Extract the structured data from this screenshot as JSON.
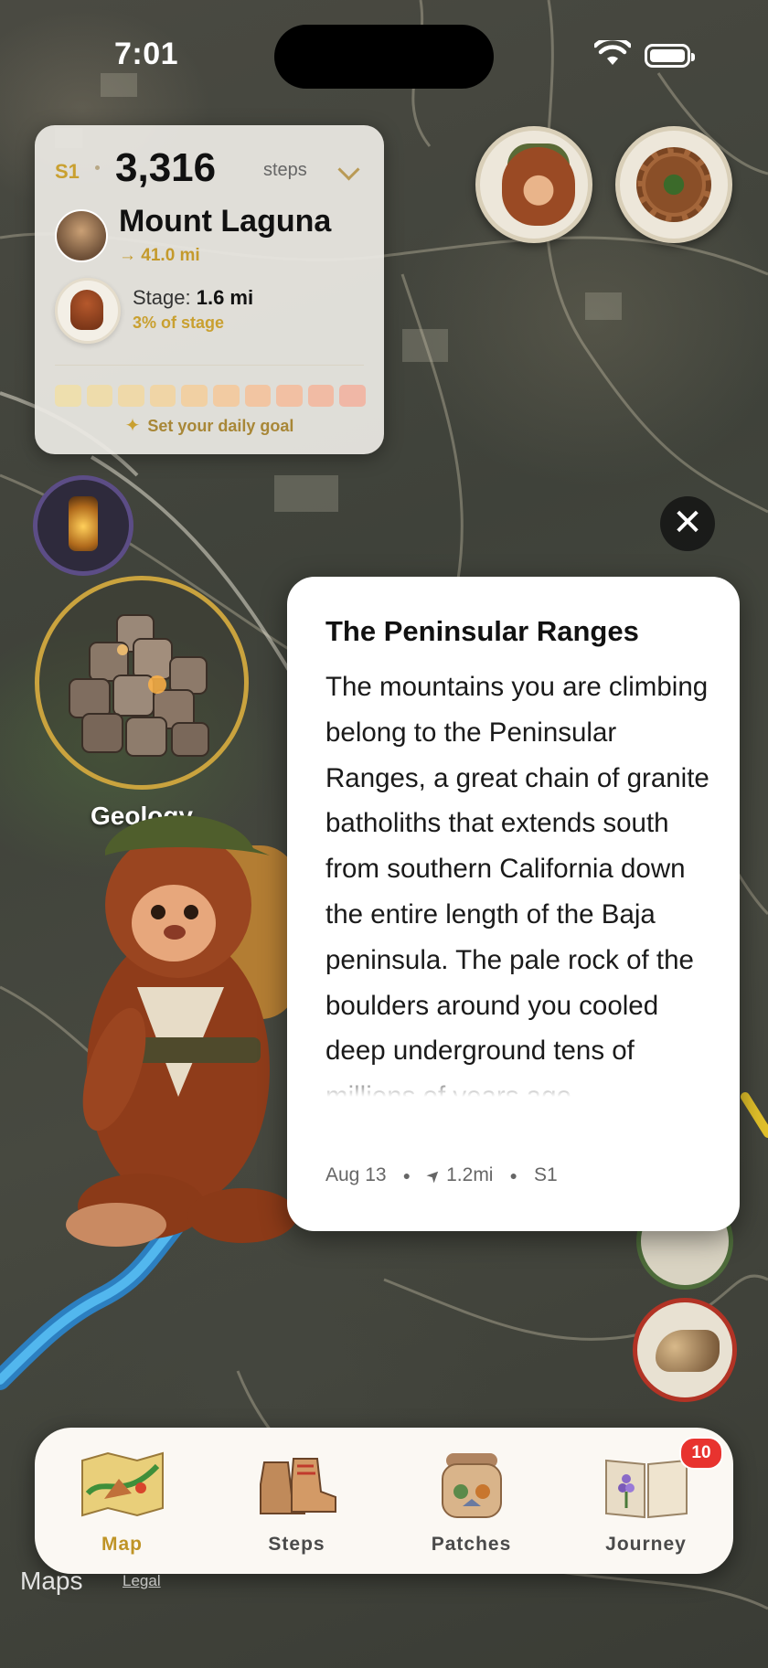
{
  "status_bar": {
    "time": "7:01"
  },
  "stats_card": {
    "season": "S1",
    "steps_value": "3,316",
    "steps_label": "steps",
    "destination": "Mount Laguna",
    "destination_distance": "→ 41.0 mi",
    "stage_label": "Stage:",
    "stage_value": "1.6 mi",
    "stage_progress": "3% of stage",
    "stage_progress_fraction": 0.03,
    "daily_goal_text": "Set your daily goal",
    "goal_segment_colors": [
      "#eedfae",
      "#eedcab",
      "#efd9a9",
      "#f0d5a6",
      "#f1d0a3",
      "#f2cba2",
      "#f2c5a2",
      "#f2c0a3",
      "#f1bba4",
      "#f0b7a6"
    ]
  },
  "map_markers": {
    "geology_label": "Geology"
  },
  "info_card": {
    "title": "The Peninsular Ranges",
    "body": "The mountains you are climbing belong to the Peninsular Ranges, a great chain of granite batholiths that extends south from southern California down the entire length of the Baja peninsula. The pale rock of the boulders around you cooled deep underground tens of millions of years ago",
    "date": "Aug 13",
    "distance": "1.2mi",
    "season": "S1"
  },
  "tab_bar": {
    "tabs": [
      {
        "label": "Map",
        "icon": "map-icon",
        "active": true
      },
      {
        "label": "Steps",
        "icon": "boots-icon",
        "active": false
      },
      {
        "label": "Patches",
        "icon": "backpack-icon",
        "active": false
      },
      {
        "label": "Journey",
        "icon": "journal-icon",
        "active": false,
        "badge": "10"
      }
    ]
  },
  "map_attribution": {
    "logo_text": "Maps",
    "legal": "Legal"
  },
  "colors": {
    "accent_gold": "#c9a030",
    "badge_red": "#e8332f",
    "geology_ring": "#caa33e"
  }
}
